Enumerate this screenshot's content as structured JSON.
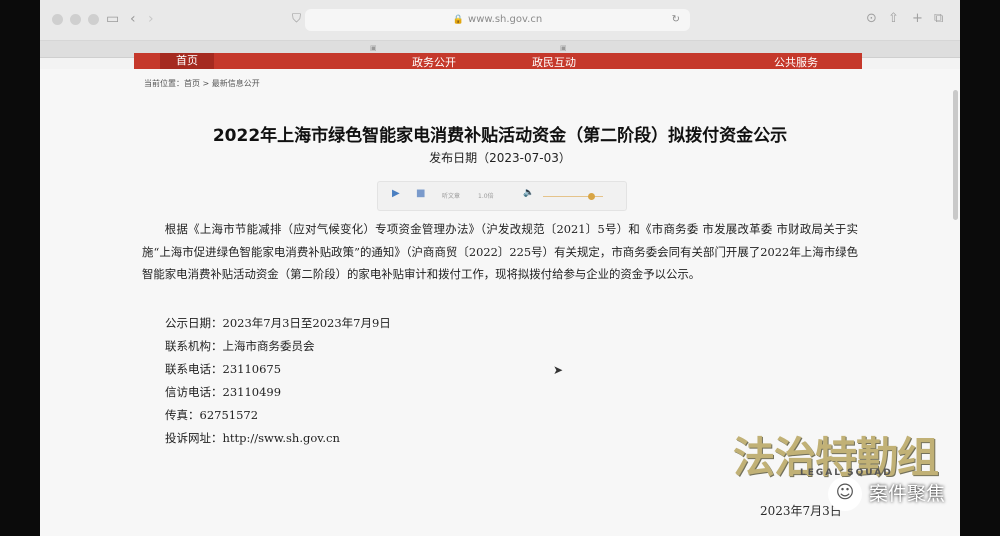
{
  "browser": {
    "url": "www.sh.gov.cn",
    "tabs": [
      "",
      "",
      "",
      "",
      "",
      ""
    ]
  },
  "site_nav": {
    "items": [
      "首页",
      "",
      "政务公开",
      "政民互动",
      "",
      "公共服务"
    ]
  },
  "breadcrumb": "当前位置：首页 > 最新信息公开",
  "article": {
    "title": "2022年上海市绿色智能家电消费补贴活动资金（第二阶段）拟拨付资金公示",
    "publish_date": "发布日期（2023-07-03）",
    "audio_player": {
      "label": "听文章",
      "speed": "1.0倍"
    },
    "body": "根据《上海市节能减排（应对气候变化）专项资金管理办法》（沪发改规范〔2021〕5号）和《市商务委 市发展改革委 市财政局关于实施“上海市促进绿色智能家电消费补贴政策”的通知》（沪商商贸〔2022〕225号）有关规定，市商务委会同有关部门开展了2022年上海市绿色智能家电消费补贴活动资金（第二阶段）的家电补贴审计和拨付工作，现将拟拨付给参与企业的资金予以公示。",
    "info_lines": [
      "公示日期：2023年7月3日至2023年7月9日",
      "联系机构：上海市商务委员会",
      "联系电话：23110675",
      "信访电话：23110499",
      "传真：62751572",
      "投诉网址：http://sww.sh.gov.cn"
    ]
  },
  "overlay": {
    "show_logo": "法治特勤组",
    "show_logo_sub": "LEGAL SQUAD",
    "date_stamp": "2023年7月3日",
    "wechat_account": "案件聚焦"
  },
  "colors": {
    "nav_red": "#c5382b",
    "nav_active": "#a52a20"
  }
}
